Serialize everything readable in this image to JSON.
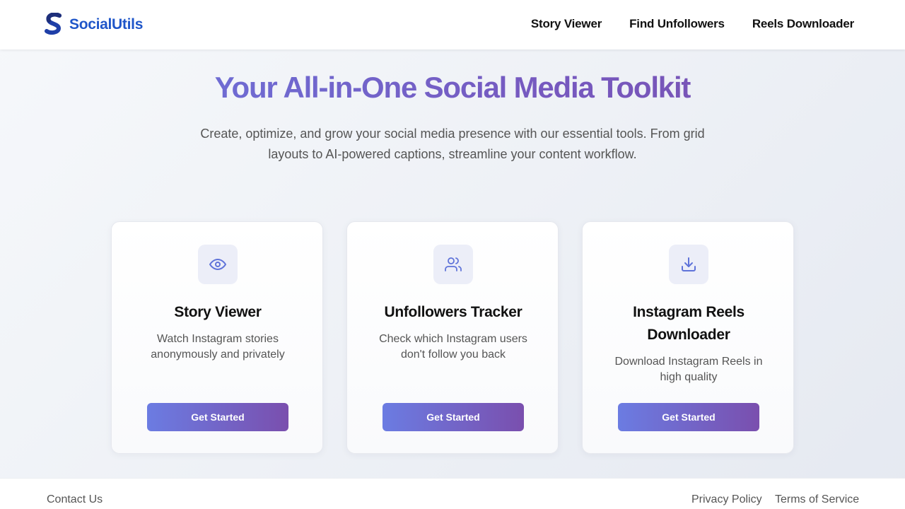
{
  "header": {
    "brand": "SocialUtils",
    "logo_icon": "s-logo-icon",
    "brand_color": "#1f56c9",
    "nav": [
      {
        "label": "Story Viewer"
      },
      {
        "label": "Find Unfollowers"
      },
      {
        "label": "Reels Downloader"
      }
    ]
  },
  "hero": {
    "title": "Your All-in-One Social Media Toolkit",
    "subtitle": "Create, optimize, and grow your social media presence with our essential tools. From grid layouts to AI-powered captions, streamline your content workflow.",
    "gradient": [
      "#6a78e0",
      "#7a4fae"
    ]
  },
  "cards": [
    {
      "icon": "eye-icon",
      "title": "Story Viewer",
      "description": "Watch Instagram stories anonymously and privately",
      "button": "Get Started"
    },
    {
      "icon": "users-icon",
      "title": "Unfollowers Tracker",
      "description": "Check which Instagram users don't follow you back",
      "button": "Get Started"
    },
    {
      "icon": "download-icon",
      "title": "Instagram Reels Downloader",
      "description": "Download Instagram Reels in high quality",
      "button": "Get Started"
    }
  ],
  "footer": {
    "contact": "Contact Us",
    "privacy": "Privacy Policy",
    "terms": "Terms of Service"
  }
}
